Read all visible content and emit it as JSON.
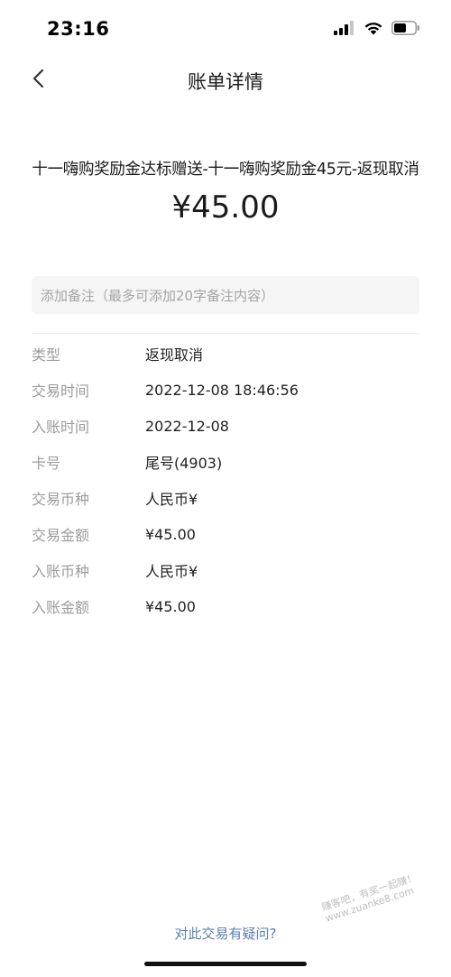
{
  "status_bar": {
    "time": "23:16"
  },
  "nav": {
    "title": "账单详情"
  },
  "transaction": {
    "title": "十一嗨购奖励金达标赠送-十一嗨购奖励金45元-返现取消",
    "amount": "¥45.00"
  },
  "note": {
    "placeholder": "添加备注（最多可添加20字备注内容）"
  },
  "details": [
    {
      "label": "类型",
      "value": "返现取消"
    },
    {
      "label": "交易时间",
      "value": "2022-12-08 18:46:56"
    },
    {
      "label": "入账时间",
      "value": "2022-12-08"
    },
    {
      "label": "卡号",
      "value": "尾号(4903)"
    },
    {
      "label": "交易币种",
      "value": "人民币¥"
    },
    {
      "label": "交易金额",
      "value": "¥45.00"
    },
    {
      "label": "入账币种",
      "value": "人民币¥"
    },
    {
      "label": "入账金额",
      "value": "¥45.00"
    }
  ],
  "footer": {
    "help_link": "对此交易有疑问?"
  },
  "watermark": {
    "line1": "赚客吧，有奖一起赚！",
    "line2": "www.zuanke8.com"
  },
  "icons": {
    "back": "chevron-left-icon",
    "signal": "cellular-signal-icon",
    "wifi": "wifi-icon",
    "battery": "battery-icon"
  },
  "colors": {
    "link": "#5a7fb0",
    "label": "#9b9b9b",
    "note_bg": "#f5f5f5"
  }
}
